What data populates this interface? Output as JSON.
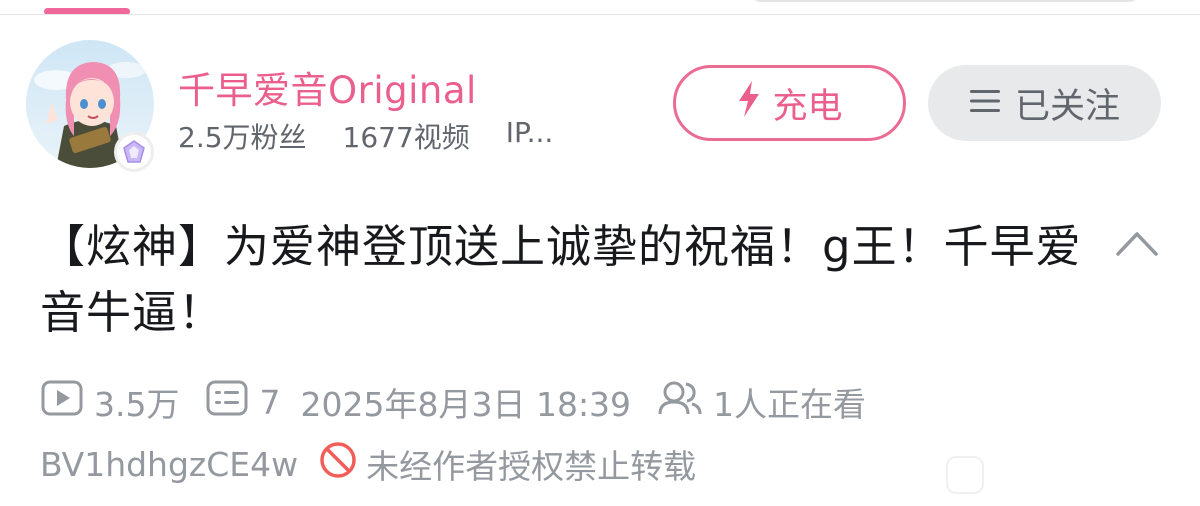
{
  "author": {
    "name": "千早爱音Original",
    "fans": "2.5万粉丝",
    "videos": "1677视频",
    "ip": "IP..."
  },
  "buttons": {
    "charge": "充电",
    "follow": "已关注"
  },
  "video": {
    "title": "【炫神】为爱神登顶送上诚挚的祝福！g王！千早爱音牛逼！",
    "views": "3.5万",
    "danmaku": "7",
    "date": "2025年8月3日 18:39",
    "watching": "1人正在看",
    "bvid": "BV1hdhgzCE4w",
    "notice": "未经作者授权禁止转载"
  },
  "icons": [
    "avatar",
    "badge-icon",
    "lightning-icon",
    "menu-icon",
    "chevron-up-icon",
    "play-icon",
    "danmaku-icon",
    "viewers-icon",
    "forbidden-icon"
  ],
  "colors": {
    "accent": "#eb5f8d",
    "meta": "#9499a0",
    "follow_bg": "#e8e9eb"
  }
}
